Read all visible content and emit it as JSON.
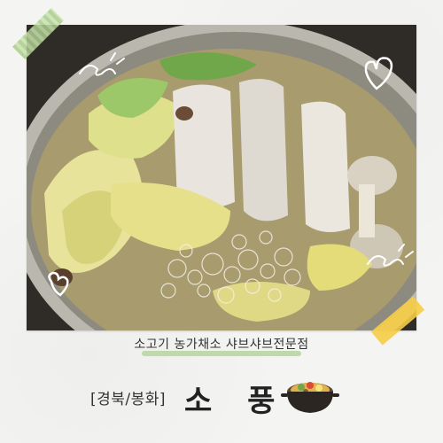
{
  "caption": {
    "subtitle": "소고기 농가채소 샤브샤브전문점",
    "region": "[경북/봉화]",
    "store_name": "소 풍"
  },
  "photo": {
    "subject": "Shabu-shabu hot pot with napa cabbage, oyster mushrooms and leafy greens in broth"
  },
  "decorations": {
    "icons": [
      "swirl-icon",
      "heart-icon",
      "heart-icon",
      "swirl-icon",
      "hotpot-icon"
    ],
    "tape_colors": [
      "#b7d59c",
      "#f6cd46"
    ],
    "accent_underline": "#b9d6a3"
  }
}
